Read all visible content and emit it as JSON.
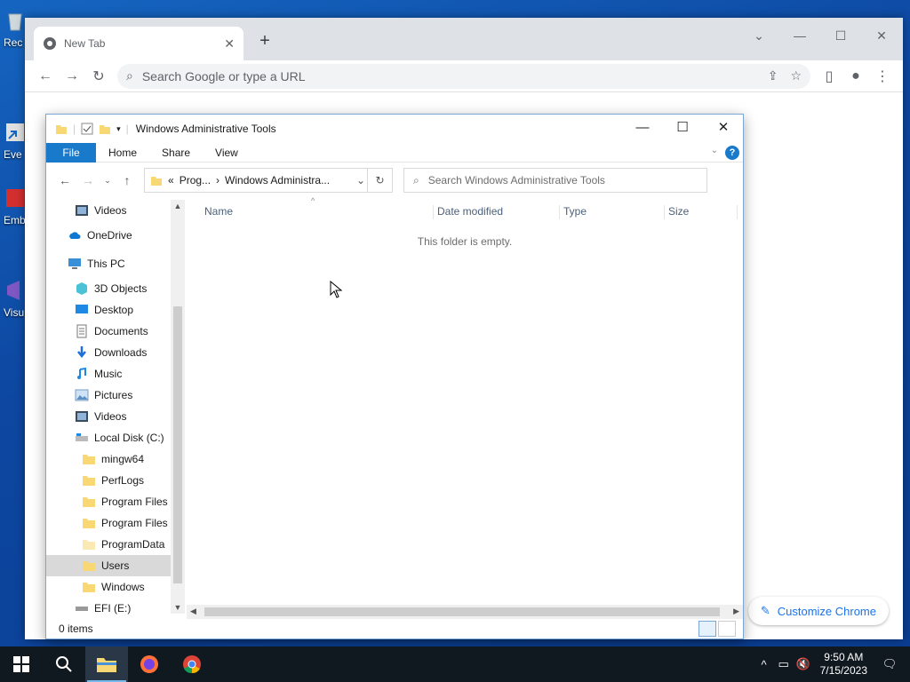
{
  "desktop": {
    "icons": [
      {
        "label": "Rec",
        "icon": "recycle-bin-icon"
      },
      {
        "label": "Eve",
        "icon": "shortcut-icon"
      },
      {
        "label": "Emb De",
        "icon": "app-icon"
      },
      {
        "label": "Visu",
        "icon": "visual-studio-icon"
      }
    ]
  },
  "chrome": {
    "tab_title": "New Tab",
    "new_tab": "+",
    "omnibox_placeholder": "Search Google or type a URL",
    "customize_label": "Customize Chrome"
  },
  "explorer": {
    "title": "Windows Administrative Tools",
    "ribbon": {
      "file": "File",
      "tabs": [
        "Home",
        "Share",
        "View"
      ],
      "help": "?"
    },
    "address": {
      "overflow": "«",
      "segments": [
        "Prog...",
        "Windows Administra..."
      ]
    },
    "search_placeholder": "Search Windows Administrative Tools",
    "nav": [
      {
        "label": "Videos",
        "icon": "videos-icon",
        "indent": 1
      },
      {
        "label": "OneDrive",
        "icon": "onedrive-icon",
        "indent": 0
      },
      {
        "label": "This PC",
        "icon": "this-pc-icon",
        "indent": 0
      },
      {
        "label": "3D Objects",
        "icon": "3d-objects-icon",
        "indent": 1
      },
      {
        "label": "Desktop",
        "icon": "desktop-icon",
        "indent": 1
      },
      {
        "label": "Documents",
        "icon": "documents-icon",
        "indent": 1
      },
      {
        "label": "Downloads",
        "icon": "downloads-icon",
        "indent": 1
      },
      {
        "label": "Music",
        "icon": "music-icon",
        "indent": 1
      },
      {
        "label": "Pictures",
        "icon": "pictures-icon",
        "indent": 1
      },
      {
        "label": "Videos",
        "icon": "videos-icon",
        "indent": 1
      },
      {
        "label": "Local Disk (C:)",
        "icon": "local-disk-icon",
        "indent": 1
      },
      {
        "label": "mingw64",
        "icon": "folder-icon",
        "indent": 2
      },
      {
        "label": "PerfLogs",
        "icon": "folder-icon",
        "indent": 2
      },
      {
        "label": "Program Files",
        "icon": "folder-icon",
        "indent": 2
      },
      {
        "label": "Program Files (",
        "icon": "folder-icon",
        "indent": 2
      },
      {
        "label": "ProgramData",
        "icon": "folder-faded-icon",
        "indent": 2
      },
      {
        "label": "Users",
        "icon": "folder-icon",
        "indent": 2,
        "selected": true
      },
      {
        "label": "Windows",
        "icon": "folder-icon",
        "indent": 2
      },
      {
        "label": "EFI (E:)",
        "icon": "drive-icon",
        "indent": 1
      }
    ],
    "columns": [
      "Name",
      "Date modified",
      "Type",
      "Size"
    ],
    "empty_message": "This folder is empty.",
    "status": "0 items"
  },
  "taskbar": {
    "apps": [
      "start-icon",
      "search-icon",
      "file-explorer-icon",
      "firefox-icon",
      "chrome-icon"
    ],
    "time": "9:50 AM",
    "date": "7/15/2023"
  },
  "colors": {
    "desktop": "#0d47a1",
    "ribbon_file": "#1979ca",
    "chrome_accent": "#1a73e8",
    "taskbar": "#101820"
  }
}
